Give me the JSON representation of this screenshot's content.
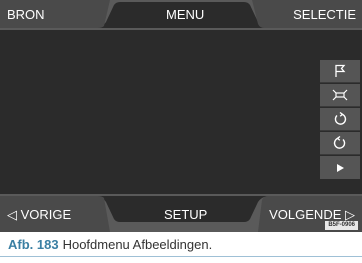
{
  "top_bar": {
    "left_label": "BRON",
    "center_label": "MENU",
    "right_label": "SELECTIE"
  },
  "bottom_bar": {
    "left_label": "◁ VORIGE",
    "center_label": "SETUP",
    "right_label": "VOLGENDE ▷"
  },
  "side_buttons": [
    {
      "icon": "flag-icon"
    },
    {
      "icon": "fit-screen-icon"
    },
    {
      "icon": "rotate-left-icon"
    },
    {
      "icon": "rotate-right-icon"
    },
    {
      "icon": "play-icon"
    }
  ],
  "figure_code": "B5F-0906",
  "caption": {
    "number": "Afb. 183",
    "text": "Hoofdmenu Afbeeldingen."
  }
}
